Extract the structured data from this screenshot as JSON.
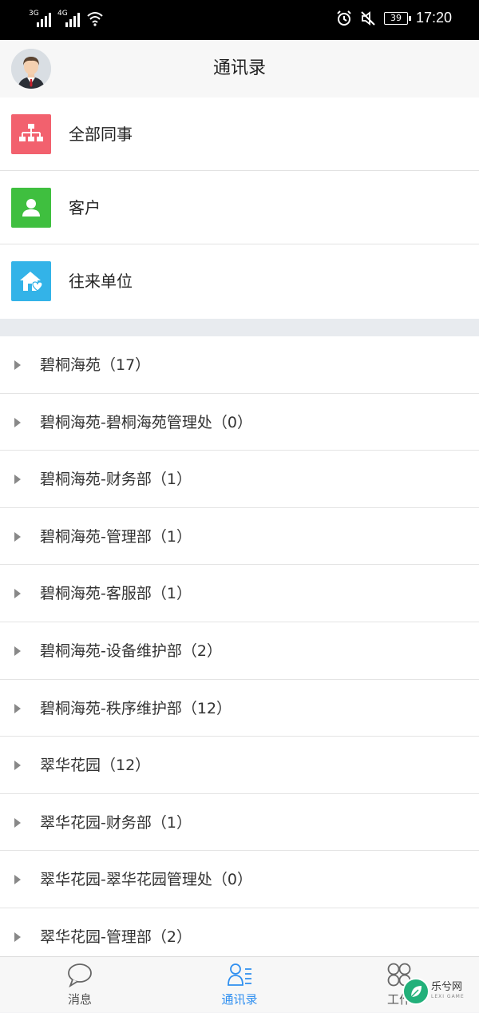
{
  "status_bar": {
    "net1": "3G",
    "net2": "4G",
    "battery": "39",
    "time": "17:20"
  },
  "header": {
    "title": "通讯录"
  },
  "categories": [
    {
      "label": "全部同事",
      "icon": "org-chart-icon",
      "color": "#f2616e"
    },
    {
      "label": "客户",
      "icon": "person-icon",
      "color": "#3fbf3f"
    },
    {
      "label": "往来单位",
      "icon": "house-heart-icon",
      "color": "#33b3e8"
    }
  ],
  "departments": [
    "碧桐海苑（17）",
    "碧桐海苑-碧桐海苑管理处（0）",
    "碧桐海苑-财务部（1）",
    "碧桐海苑-管理部（1）",
    "碧桐海苑-客服部（1）",
    "碧桐海苑-设备维护部（2）",
    "碧桐海苑-秩序维护部（12）",
    "翠华花园（12）",
    "翠华花园-财务部（1）",
    "翠华花园-翠华花园管理处（0）",
    "翠华花园-管理部（2）"
  ],
  "tabs": [
    {
      "label": "消息",
      "icon": "chat-bubble-icon",
      "active": false
    },
    {
      "label": "通讯录",
      "icon": "contacts-icon",
      "active": true
    },
    {
      "label": "工作",
      "icon": "clover-grid-icon",
      "active": false
    }
  ],
  "watermark": {
    "text": "乐兮网",
    "sub": "LEXI GAME"
  },
  "colors": {
    "accent": "#2f8ff0"
  }
}
